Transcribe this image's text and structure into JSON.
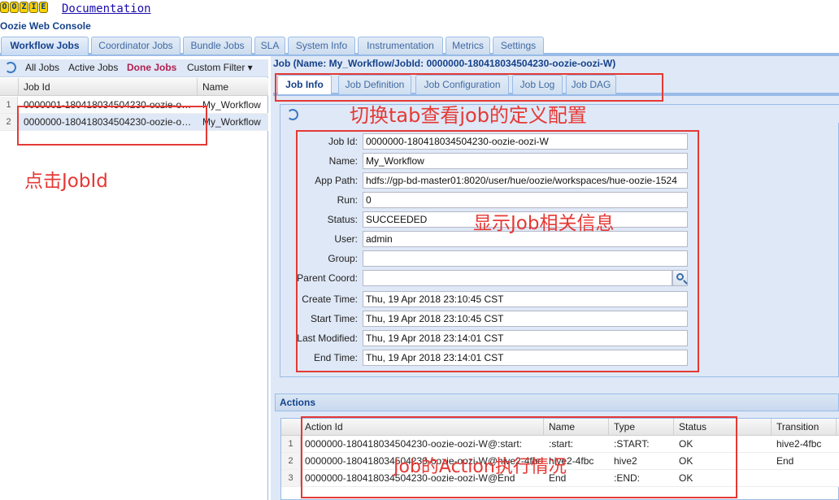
{
  "header": {
    "logo_letters": [
      "O",
      "O",
      "Z",
      "I",
      "E"
    ],
    "doc_link": "Documentation",
    "console_title": "Oozie Web Console"
  },
  "main_tabs": [
    {
      "label": "Workflow Jobs",
      "active": true
    },
    {
      "label": "Coordinator Jobs",
      "active": false
    },
    {
      "label": "Bundle Jobs",
      "active": false
    },
    {
      "label": "SLA",
      "active": false
    },
    {
      "label": "System Info",
      "active": false
    },
    {
      "label": "Instrumentation",
      "active": false
    },
    {
      "label": "Metrics",
      "active": false
    },
    {
      "label": "Settings",
      "active": false
    }
  ],
  "left": {
    "toolbar": {
      "all_jobs": "All Jobs",
      "active_jobs": "Active Jobs",
      "done_jobs": "Done Jobs",
      "custom_filter": "Custom Filter ▾"
    },
    "columns": {
      "job_id": "Job Id",
      "name": "Name"
    },
    "rows": [
      {
        "num": "1",
        "job_id": "0000001-180418034504230-oozie-oozi-W",
        "name": "My_Workflow"
      },
      {
        "num": "2",
        "job_id": "0000000-180418034504230-oozie-oozi-W",
        "name": "My_Workflow"
      }
    ]
  },
  "job": {
    "title": "Job (Name: My_Workflow/JobId: 0000000-180418034504230-oozie-oozi-W)",
    "tabs": [
      {
        "label": "Job Info",
        "active": true
      },
      {
        "label": "Job Definition",
        "active": false
      },
      {
        "label": "Job Configuration",
        "active": false
      },
      {
        "label": "Job Log",
        "active": false
      },
      {
        "label": "Job DAG",
        "active": false
      }
    ],
    "fields": {
      "job_id": {
        "label": "Job Id:",
        "value": "0000000-180418034504230-oozie-oozi-W"
      },
      "name": {
        "label": "Name:",
        "value": "My_Workflow"
      },
      "app_path": {
        "label": "App Path:",
        "value": "hdfs://gp-bd-master01:8020/user/hue/oozie/workspaces/hue-oozie-1524"
      },
      "run": {
        "label": "Run:",
        "value": "0"
      },
      "status": {
        "label": "Status:",
        "value": "SUCCEEDED"
      },
      "user": {
        "label": "User:",
        "value": "admin"
      },
      "group": {
        "label": "Group:",
        "value": ""
      },
      "parent_coord": {
        "label": "Parent Coord:",
        "value": ""
      },
      "create_time": {
        "label": "Create Time:",
        "value": "Thu, 19 Apr 2018 23:10:45 CST"
      },
      "start_time": {
        "label": "Start Time:",
        "value": "Thu, 19 Apr 2018 23:10:45 CST"
      },
      "last_modified": {
        "label": "Last Modified:",
        "value": "Thu, 19 Apr 2018 23:14:01 CST"
      },
      "end_time": {
        "label": "End Time:",
        "value": "Thu, 19 Apr 2018 23:14:01 CST"
      }
    }
  },
  "actions": {
    "title": "Actions",
    "columns": {
      "action_id": "Action Id",
      "name": "Name",
      "type": "Type",
      "status": "Status",
      "transition": "Transition"
    },
    "rows": [
      {
        "num": "1",
        "action_id": "0000000-180418034504230-oozie-oozi-W@:start:",
        "name": ":start:",
        "type": ":START:",
        "status": "OK",
        "transition": "hive2-4fbc"
      },
      {
        "num": "2",
        "action_id": "0000000-180418034504230-oozie-oozi-W@hive2-4fbc",
        "name": "hive2-4fbc",
        "type": "hive2",
        "status": "OK",
        "transition": "End"
      },
      {
        "num": "3",
        "action_id": "0000000-180418034504230-oozie-oozi-W@End",
        "name": "End",
        "type": ":END:",
        "status": "OK",
        "transition": ""
      }
    ]
  },
  "annotations": {
    "switch_tab": "切换tab查看job的定义配置",
    "click_jobid": "点击JobId",
    "show_info": "显示Job相关信息",
    "action_status": "Job的Action执行情况"
  },
  "colors": {
    "annotation": "#e53935",
    "panel": "#dfe8f6",
    "border": "#99bbe8",
    "title": "#15428b"
  }
}
